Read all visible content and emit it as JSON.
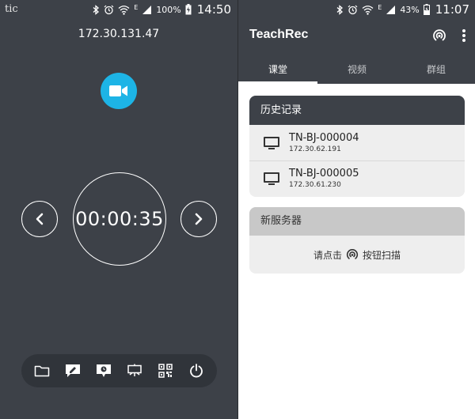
{
  "left": {
    "status": {
      "carrier": "tic",
      "battery": "100%",
      "time": "14:50"
    },
    "ip": "172.30.131.47",
    "timer": "00:00:35",
    "toolbar": [
      {
        "name": "folder-icon"
      },
      {
        "name": "annotate-icon"
      },
      {
        "name": "clock-screen-icon"
      },
      {
        "name": "presentation-icon"
      },
      {
        "name": "qr-code-icon"
      },
      {
        "name": "power-icon"
      }
    ]
  },
  "right": {
    "status": {
      "battery": "43%",
      "time": "11:07"
    },
    "app_title": "TeachRec",
    "tabs": [
      {
        "label": "课堂",
        "active": true
      },
      {
        "label": "视频",
        "active": false
      },
      {
        "label": "群组",
        "active": false
      }
    ],
    "history": {
      "title": "历史记录",
      "servers": [
        {
          "name": "TN-BJ-000004",
          "ip": "172.30.62.191"
        },
        {
          "name": "TN-BJ-000005",
          "ip": "172.30.61.230"
        }
      ]
    },
    "new_server": {
      "title": "新服务器",
      "hint_before": "请点击",
      "hint_after": "按钮扫描"
    }
  },
  "colors": {
    "dark_bg": "#3d4148",
    "accent": "#1db4e6",
    "card_bg": "#eeeeee",
    "new_server_header": "#c8c8c8"
  }
}
